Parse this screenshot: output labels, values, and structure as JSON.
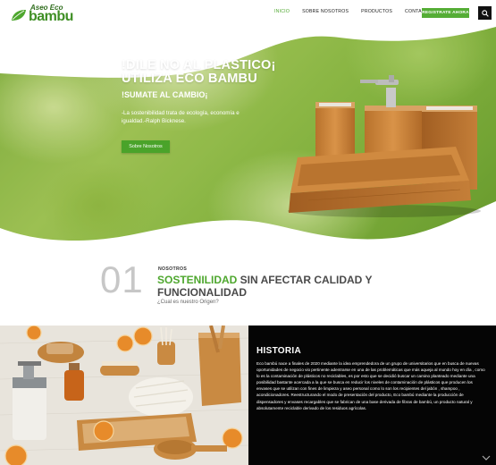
{
  "brand": {
    "top": "Aseo Eco",
    "main": "bambu"
  },
  "nav": {
    "items": [
      "INICIO",
      "SOBRE NOSOTROS",
      "PRODUCTOS",
      "CONTACTENOS"
    ],
    "cta": "REGISTRATE AHORA"
  },
  "hero": {
    "title_line1": "!DILE NO AL PLASTICO¡",
    "title_line2": "UTILIZA ECO BAMBU",
    "subtitle": "!SUMATE AL CAMBIO¡",
    "quote": "-La sostenibilidad trata de ecología, economía e igualdad.-Ralph Bicknese.",
    "button": "Sobre Nosotros"
  },
  "section01": {
    "number": "01",
    "eyebrow": "NOSOTROS",
    "title_green": "SOSTENILIDAD",
    "title_rest": " SIN AFECTAR CALIDAD Y FUNCIONALIDAD",
    "subtitle": "¿Cual es nuestro Origen?"
  },
  "historia": {
    "title": "HISTORIA",
    "body": "Eco bambú nace a finales de 2020 mediante la idea emprendedora de un grupo de universitarios que en busca de nuevas oportunidades de negocio vio pertinente adentrarse en una de las problemáticas que más aqueja al mundo hoy en día , como lo es la contaminación de plásticos no reciclables, es por esto que se decidió buscar un camino planteado mediante una posibilidad bastante acercada a la que se busca en reducir los niveles de contaminación de plásticos que producen los envases que se utilizan con fines de limpieza y aseo personal como lo son los recipientes del jabón , shampoo , acondicionadores. Reestructurando el modo de presentación del producto, Eco bambú mediante la producción de dispensadores y envases recargables que se fabrican de una base derivada de fibras de bambú, un producto natural y absolutamente reciclable derivado de los residuos agrícolas."
  },
  "colors": {
    "accent": "#4ea72e",
    "dark": "#050505"
  },
  "icons": [
    "leaf-icon",
    "search-icon",
    "chevron-down-icon"
  ]
}
